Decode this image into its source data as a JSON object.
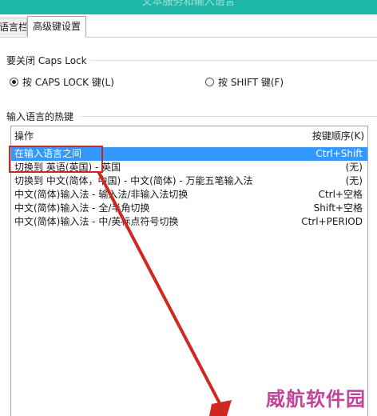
{
  "window": {
    "title": "文本服务和输入语言",
    "titlebar_color": "#1fb7a8"
  },
  "tabs": [
    {
      "label": "语言栏",
      "visible_label": "语言栏",
      "active": false
    },
    {
      "label": "高级键设置",
      "active": true
    }
  ],
  "caps_lock_group": {
    "label": "要关闭 Caps Lock",
    "options": [
      {
        "label": "按 CAPS LOCK 键(L)",
        "checked": true
      },
      {
        "label": "按 SHIFT 键(F)",
        "checked": false
      }
    ]
  },
  "hotkeys_group": {
    "label": "输入语言的热键",
    "columns": {
      "action": "操作",
      "keys": "按键顺序(K)"
    },
    "rows": [
      {
        "action": "在输入语言之间",
        "keys": "Ctrl+Shift",
        "selected": true
      },
      {
        "action": "切换到 英语(英国) - 英国",
        "keys": "(无)",
        "selected": false
      },
      {
        "action": "切换到 中文(简体，中国) - 中文(简体) - 万能五笔输入法",
        "keys": "(无)",
        "selected": false
      },
      {
        "action": "中文(简体)输入法 - 输入法/非输入法切换",
        "keys": "Ctrl+空格",
        "selected": false
      },
      {
        "action": "中文(简体)输入法 - 全/半角切换",
        "keys": "Shift+空格",
        "selected": false
      },
      {
        "action": "中文(简体)输入法 - 中/英标点符号切换",
        "keys": "Ctrl+PERIOD",
        "selected": false
      }
    ],
    "selected_color": "#3399ff"
  },
  "annotation": {
    "color": "#d0281f"
  },
  "watermark": {
    "text": "威航软件园",
    "color": "#c0459a"
  }
}
